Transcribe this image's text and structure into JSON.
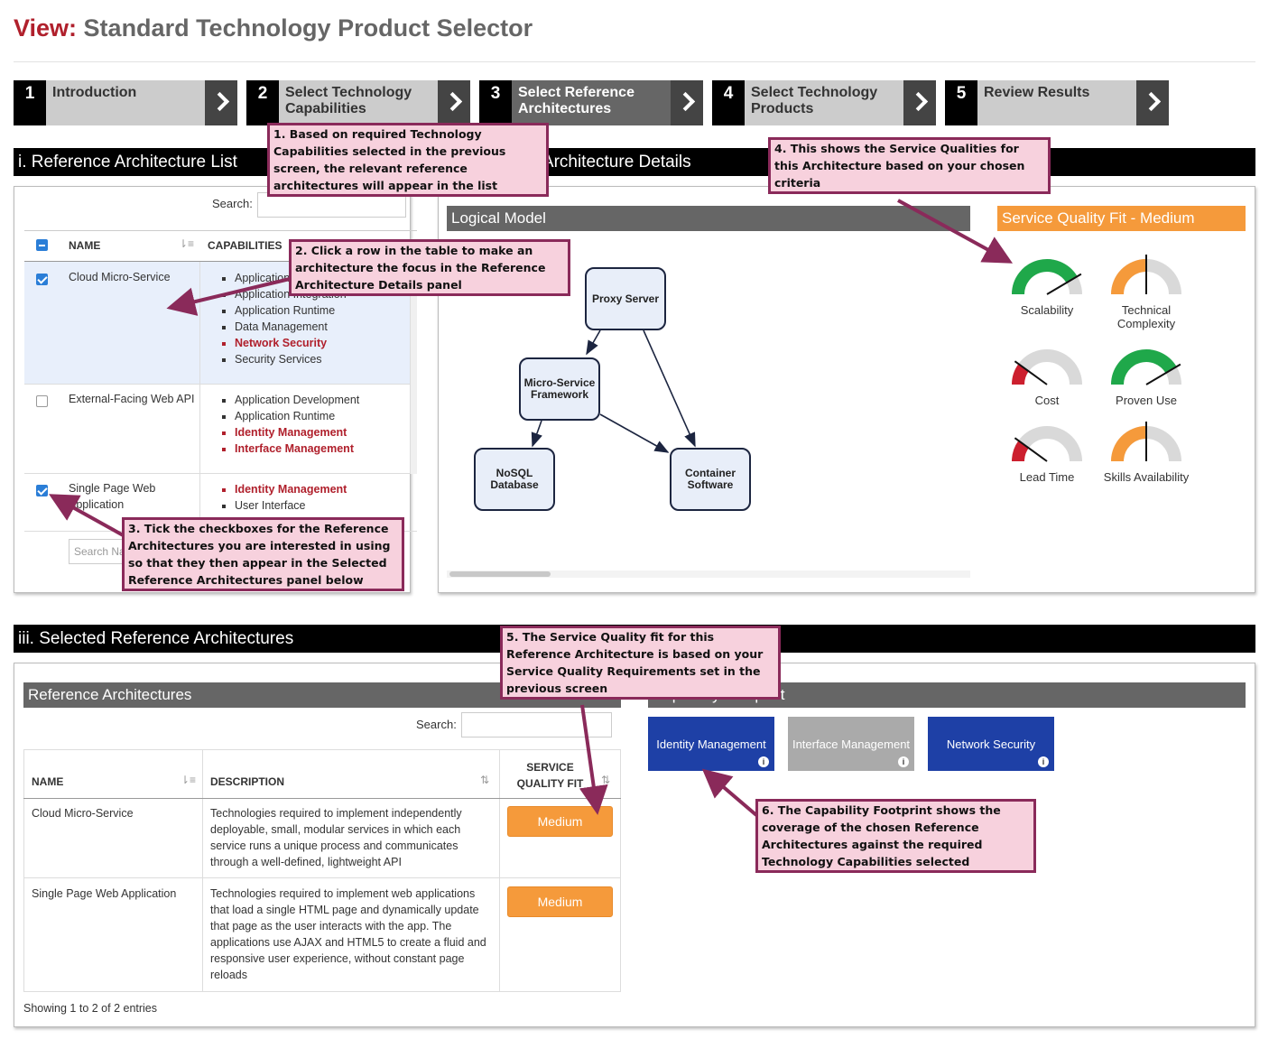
{
  "header": {
    "view_prefix": "View:",
    "title": "Standard Technology Product Selector"
  },
  "steps": [
    {
      "num": "1",
      "label": "Introduction"
    },
    {
      "num": "2",
      "label": "Select Technology Capabilities"
    },
    {
      "num": "3",
      "label": "Select Reference Architectures"
    },
    {
      "num": "4",
      "label": "Select Technology Products"
    },
    {
      "num": "5",
      "label": "Review Results"
    }
  ],
  "list_section": {
    "title": "i. Reference Architecture List",
    "search_label": "Search:",
    "col_name": "NAME",
    "col_caps": "CAPABILITIES",
    "footer_search_placeholder": "Search Name",
    "rows": [
      {
        "name": "Cloud Micro-Service",
        "caps": [
          {
            "label": "Application Development",
            "req": false
          },
          {
            "label": "Application Integration",
            "req": false
          },
          {
            "label": "Application Runtime",
            "req": false
          },
          {
            "label": "Data Management",
            "req": false
          },
          {
            "label": "Network Security",
            "req": true
          },
          {
            "label": "Security Services",
            "req": false
          }
        ]
      },
      {
        "name": "External-Facing Web API",
        "caps": [
          {
            "label": "Application Development",
            "req": false
          },
          {
            "label": "Application Runtime",
            "req": false
          },
          {
            "label": "Identity Management",
            "req": true
          },
          {
            "label": "Interface Management",
            "req": true
          }
        ]
      },
      {
        "name": "Single Page Web Application",
        "caps": [
          {
            "label": "Identity Management",
            "req": true
          },
          {
            "label": "User Interface",
            "req": false
          }
        ]
      }
    ]
  },
  "details_section": {
    "title": "ii. Reference Architecture Details",
    "logical_model_title": "Logical Model",
    "nodes": {
      "proxy": "Proxy Server",
      "framework": "Micro-Service Framework",
      "nosql": "NoSQL Database",
      "container": "Container Software"
    },
    "sqf_title": "Service Quality Fit - Medium",
    "gauges": [
      {
        "label": "Scalability",
        "level": "high"
      },
      {
        "label": "Technical Complexity",
        "level": "medium"
      },
      {
        "label": "Cost",
        "level": "low"
      },
      {
        "label": "Proven Use",
        "level": "high"
      },
      {
        "label": "Lead Time",
        "level": "low"
      },
      {
        "label": "Skills Availability",
        "level": "medium"
      }
    ],
    "colors": {
      "high": "#1fa84a",
      "medium": "#f59a3b",
      "low": "#cc1f2e",
      "track": "#d9d9d9"
    }
  },
  "selected_section": {
    "title": "iii. Selected Reference Architectures",
    "ref_arch_title": "Reference Architectures",
    "search_label": "Search:",
    "col_name": "NAME",
    "col_desc": "DESCRIPTION",
    "col_sqf": "SERVICE QUALITY FIT",
    "rows": [
      {
        "name": "Cloud Micro-Service",
        "desc": "Technologies required to implement independently deployable, small, modular services in which each service runs a unique process and communicates through a well-defined, lightweight API",
        "fit": "Medium"
      },
      {
        "name": "Single Page Web Application",
        "desc": "Technologies required to implement web applications that load a single HTML page and dynamically update that page as the user interacts with the app. The applications use AJAX and HTML5 to create a fluid and responsive user experience, without constant page reloads",
        "fit": "Medium"
      }
    ],
    "showing": "Showing 1 to 2 of 2 entries",
    "footprint_title": "Capability Footprint",
    "footprint": [
      {
        "label": "Identity Management",
        "color": "#1e40a6"
      },
      {
        "label": "Interface Management",
        "color": "#aaaaaa"
      },
      {
        "label": "Network Security",
        "color": "#1e40a6"
      }
    ]
  },
  "callouts": {
    "c1": "1. Based on required Technology Capabilities selected in the previous screen, the relevant reference architectures will appear in the list",
    "c2": "2. Click a row in the table to make an architecture the focus in the Reference Architecture Details panel",
    "c3": "3. Tick the checkboxes for the Reference Architectures you are interested in using so that they then appear in the Selected Reference Architectures panel below",
    "c4": "4. This shows the Service Qualities for this Architecture based on your chosen criteria",
    "c5": "5. The Service Quality fit for this Reference Architecture is based on your Service Quality Requirements set in the previous screen",
    "c6": "6. The Capability Footprint shows the coverage of the chosen Reference Architectures against the required Technology Capabilities selected"
  }
}
